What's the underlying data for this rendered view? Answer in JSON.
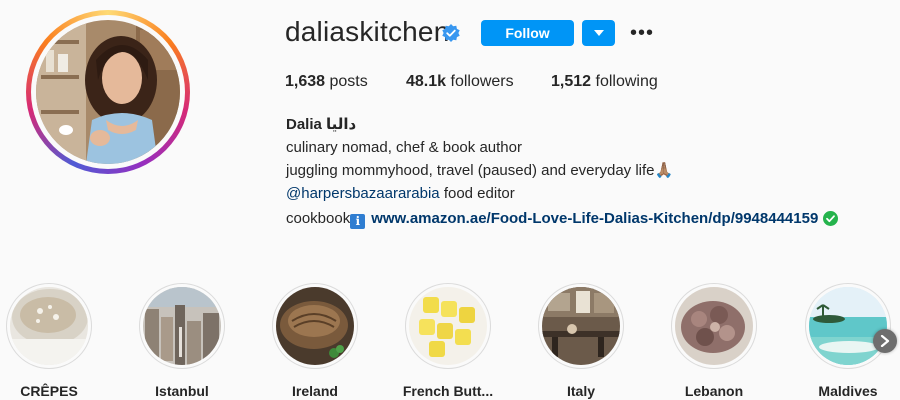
{
  "profile": {
    "username": "daliaskitchen",
    "verified": true,
    "follow_label": "Follow",
    "dropdown_icon": "caret-down-icon",
    "more_icon": "more-options-icon",
    "more_label": "•••"
  },
  "stats": {
    "posts_value": "1,638",
    "posts_label": "posts",
    "followers_value": "48.1k",
    "followers_label": "followers",
    "following_value": "1,512",
    "following_label": "following"
  },
  "bio": {
    "name": "Dalia داليا",
    "line1": "culinary nomad, chef & book author",
    "line2": "juggling mommyhood, travel (paused) and everyday life🙏🏽",
    "mention": "@harpersbazaararabia",
    "mention_suffix": " food editor",
    "cookbook_label": "cookbook",
    "info_glyph": "ℹ",
    "link": "www.amazon.ae/Food-Love-Life-Dalias-Kitchen/dp/9948444159"
  },
  "highlights": [
    {
      "label": "CRÊPES"
    },
    {
      "label": "Istanbul"
    },
    {
      "label": "Ireland"
    },
    {
      "label": "French Butt..."
    },
    {
      "label": "Italy"
    },
    {
      "label": "Lebanon"
    },
    {
      "label": "Maldives"
    }
  ],
  "colors": {
    "accent": "#0095f6",
    "link": "#00376b",
    "verified_badge": "#3897f0",
    "check": "#25b34c"
  }
}
